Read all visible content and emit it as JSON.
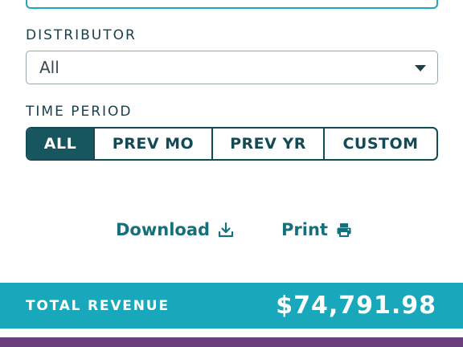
{
  "filters": {
    "distributor": {
      "label": "DISTRIBUTOR",
      "selected": "All"
    },
    "time_period": {
      "label": "TIME PERIOD",
      "options": [
        "ALL",
        "PREV MO",
        "PREV YR",
        "CUSTOM"
      ],
      "active": "ALL"
    }
  },
  "actions": {
    "download_label": "Download",
    "download_icon": "download-icon",
    "print_label": "Print",
    "print_icon": "printer-icon"
  },
  "summary": {
    "total_revenue_label": "TOTAL REVENUE",
    "total_revenue_value": "$74,791.98"
  },
  "colors": {
    "teal_accent": "#19a8bb",
    "dark_teal": "#17555f",
    "link_teal": "#16707c",
    "purple": "#6a3e7a"
  }
}
